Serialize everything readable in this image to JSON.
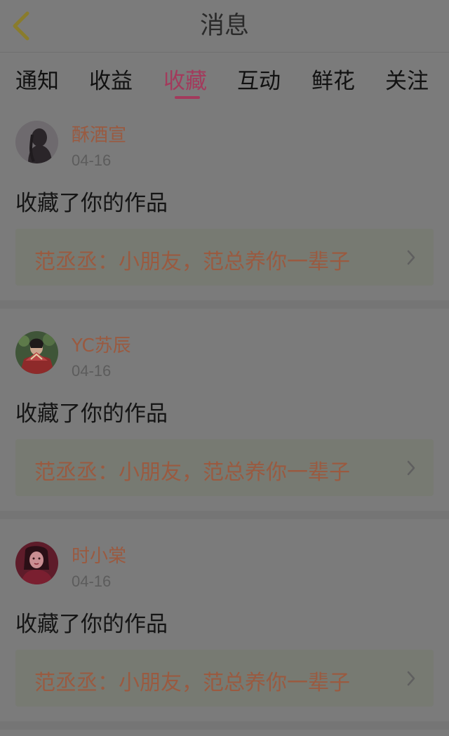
{
  "header": {
    "title": "消息"
  },
  "tabs": [
    {
      "label": "通知"
    },
    {
      "label": "收益"
    },
    {
      "label": "收藏"
    },
    {
      "label": "互动"
    },
    {
      "label": "鲜花"
    },
    {
      "label": "关注"
    }
  ],
  "active_tab": "收藏",
  "colors": {
    "accent": "#a33a5c",
    "username": "#9a5a40",
    "back_arrow": "#8a7c2c"
  },
  "items": [
    {
      "username": "酥酒宣",
      "date": "04-16",
      "action": "收藏了你的作品",
      "work": "范丞丞：小朋友，范总养你一辈子",
      "avatar": "avatar-silhouette"
    },
    {
      "username": "YC苏辰",
      "date": "04-16",
      "action": "收藏了你的作品",
      "work": "范丞丞：小朋友，范总养你一辈子",
      "avatar": "avatar-fan-girl"
    },
    {
      "username": "时小棠",
      "date": "04-16",
      "action": "收藏了你的作品",
      "work": "范丞丞：小朋友，范总养你一辈子",
      "avatar": "avatar-red-portrait"
    }
  ]
}
